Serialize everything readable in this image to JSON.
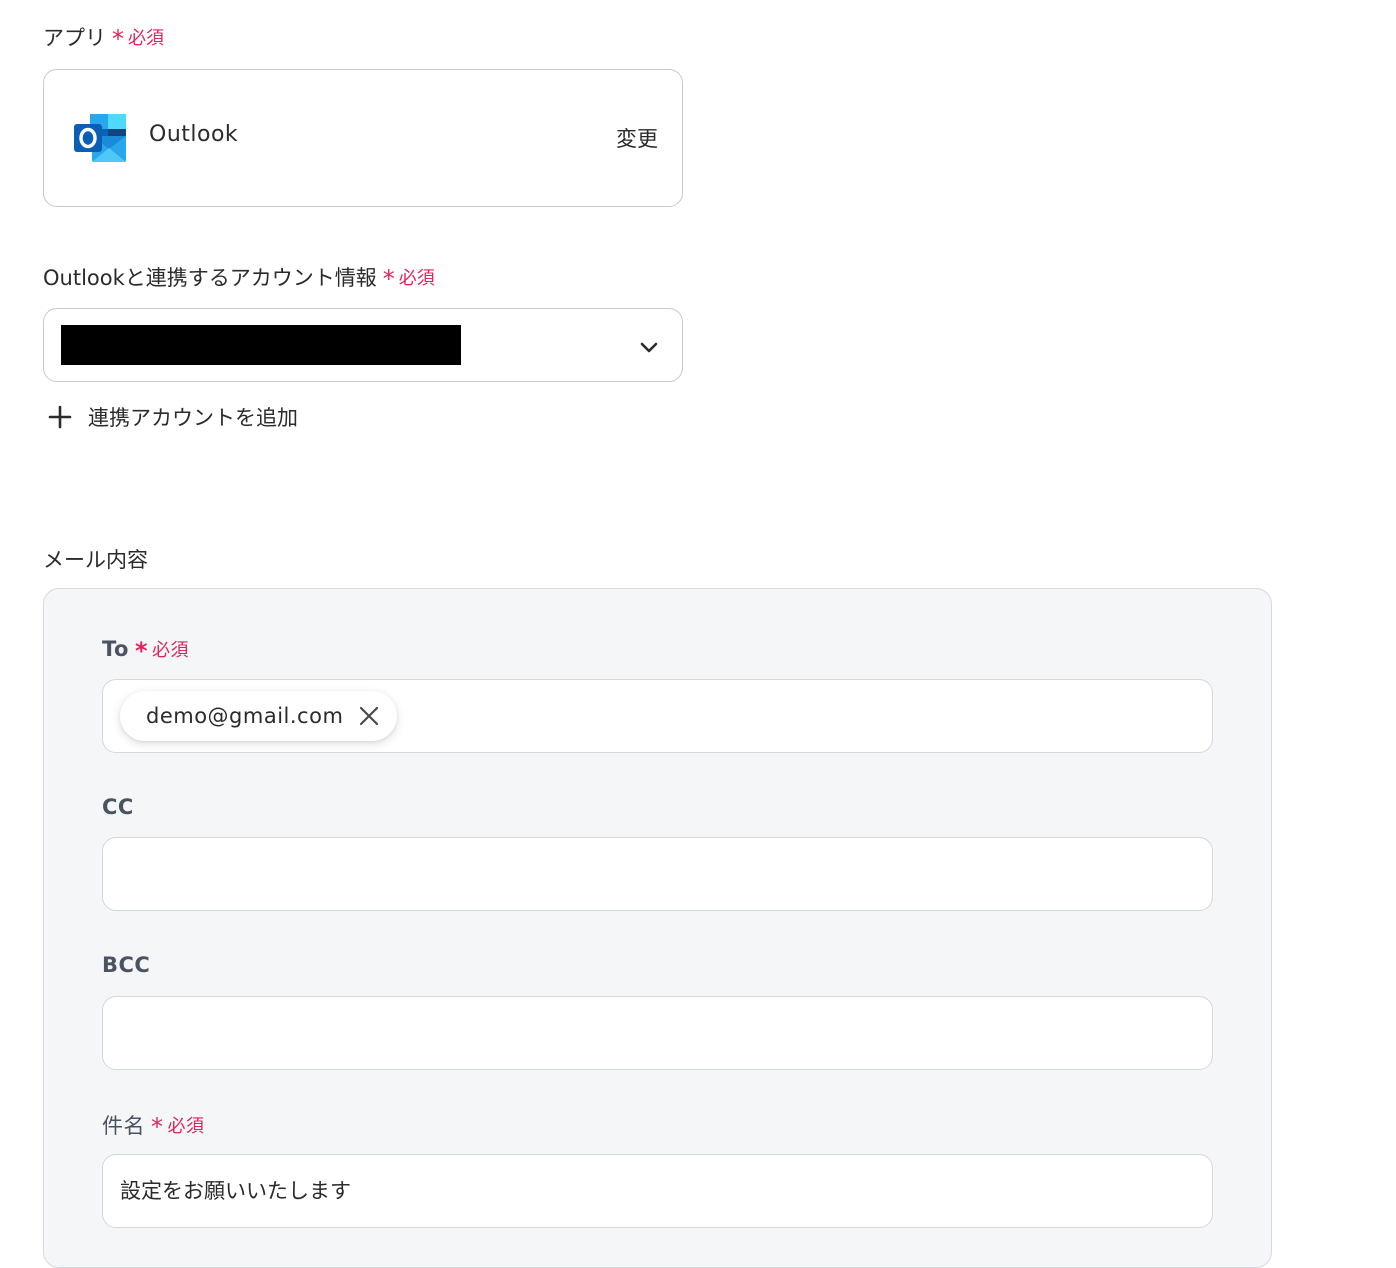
{
  "app_section": {
    "label": "アプリ",
    "required_star": "*",
    "required_text": "必須",
    "app_name": "Outlook",
    "change_label": "変更",
    "icon": "outlook-icon"
  },
  "account_section": {
    "label": "Outlookと連携するアカウント情報",
    "required_star": "*",
    "required_text": "必須",
    "add_account_label": "連携アカウントを追加"
  },
  "mail_section": {
    "title": "メール内容",
    "to": {
      "label": "To",
      "required_star": "*",
      "required_text": "必須",
      "chips": [
        "demo@gmail.com"
      ]
    },
    "cc": {
      "label": "CC",
      "value": ""
    },
    "bcc": {
      "label": "BCC",
      "value": ""
    },
    "subject": {
      "label": "件名",
      "required_star": "*",
      "required_text": "必須",
      "value": "設定をお願いいたします"
    }
  },
  "colors": {
    "required": "#e0245e",
    "panel_bg": "#f5f6f8",
    "border": "#c9c9c9"
  }
}
